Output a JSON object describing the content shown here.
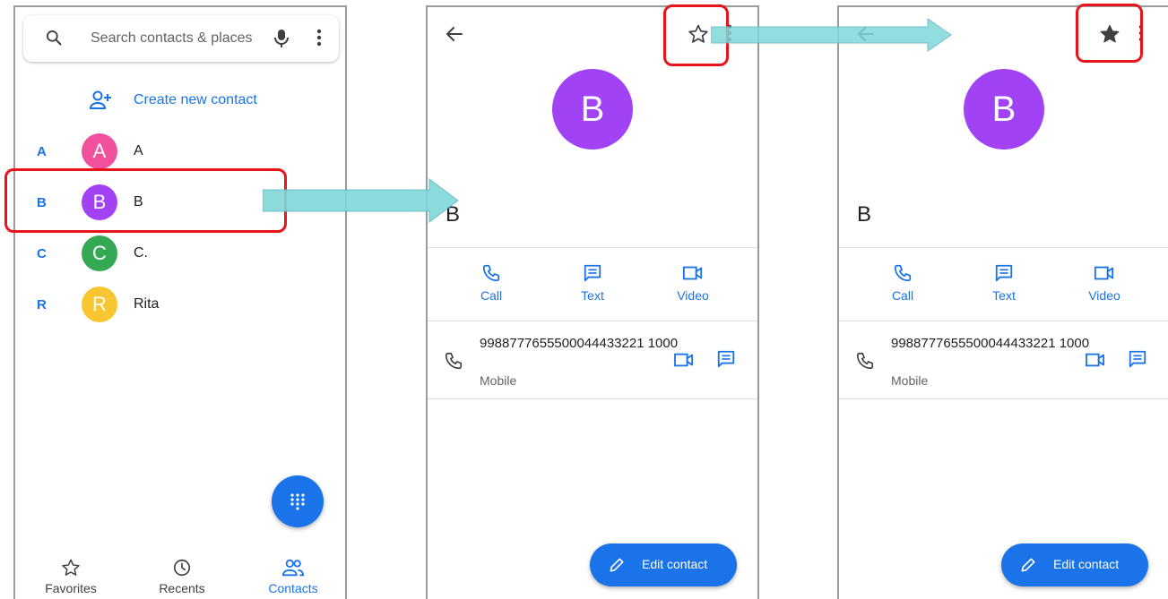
{
  "colors": {
    "accent": "#1a73e8",
    "highlight": "#e8141b",
    "arrow": "#7fd8d8"
  },
  "screen1": {
    "search_placeholder": "Search contacts & places",
    "create_label": "Create new contact",
    "contacts": [
      {
        "letter": "A",
        "initial": "A",
        "name": "A",
        "color": "#f0509c"
      },
      {
        "letter": "B",
        "initial": "B",
        "name": "B",
        "color": "#a142f4"
      },
      {
        "letter": "C",
        "initial": "C",
        "name": "C.",
        "color": "#34a853"
      },
      {
        "letter": "R",
        "initial": "R",
        "name": "Rita",
        "color": "#f9c531"
      }
    ],
    "nav": [
      {
        "label": "Favorites",
        "icon": "star-icon"
      },
      {
        "label": "Recents",
        "icon": "clock-icon"
      },
      {
        "label": "Contacts",
        "icon": "people-icon"
      }
    ]
  },
  "detail": {
    "avatar_initial": "B",
    "name": "B",
    "actions": [
      {
        "label": "Call",
        "icon": "phone-icon"
      },
      {
        "label": "Text",
        "icon": "message-icon"
      },
      {
        "label": "Video",
        "icon": "video-icon"
      }
    ],
    "phone_number": "9988777655500044433221 1000",
    "phone_type": "Mobile",
    "edit_label": "Edit contact"
  }
}
